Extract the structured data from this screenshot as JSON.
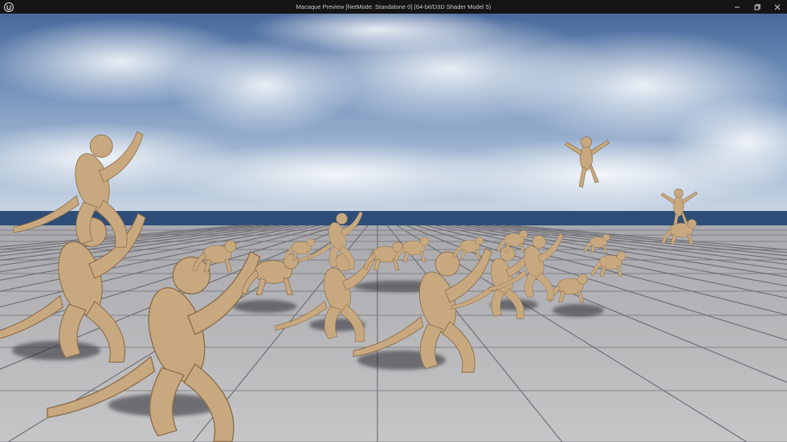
{
  "window": {
    "title": "Macaque Preview [NetMode: Standalone 0]  (64-bit/D3D Shader Model 5)",
    "controls": {
      "minimize": "minimize",
      "restore": "restore",
      "close": "close"
    }
  },
  "scene": {
    "subject": "macaque",
    "sky_top_color": "#4a6fa5",
    "sky_horizon_color": "#c7d6e6",
    "sea_color": "#2f4f7a",
    "floor_color": "#bcbcbe",
    "grid_line_color": "#6e6e74",
    "monkey_color": "#c9ab82"
  }
}
